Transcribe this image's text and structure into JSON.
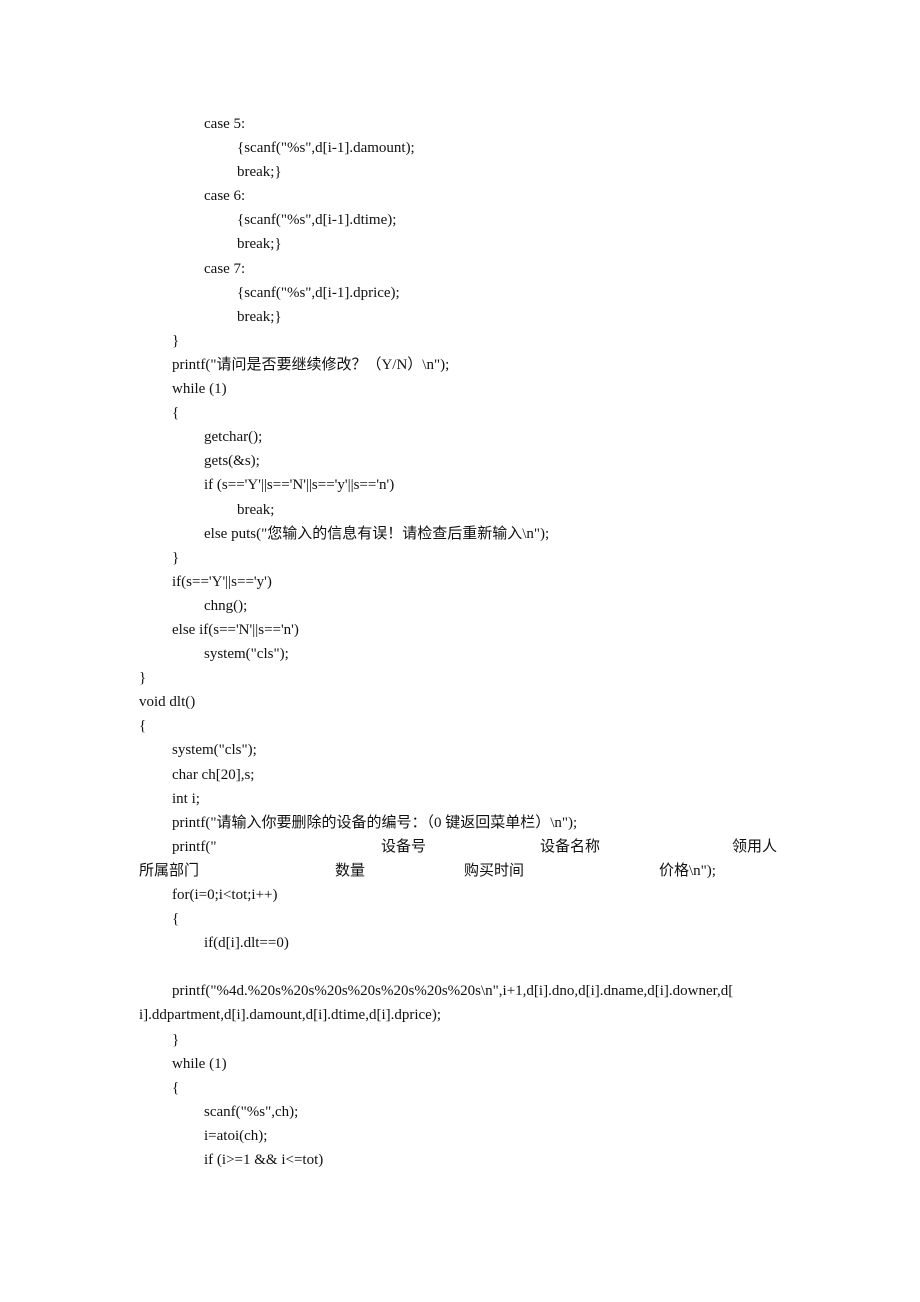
{
  "document": {
    "lines": [
      {
        "indent": 2,
        "text": "case 5:"
      },
      {
        "indent": 3,
        "text": "{scanf(\"%s\",d[i-1].damount);"
      },
      {
        "indent": 3,
        "text": "break;}"
      },
      {
        "indent": 2,
        "text": "case 6:"
      },
      {
        "indent": 3,
        "text": "{scanf(\"%s\",d[i-1].dtime);"
      },
      {
        "indent": 3,
        "text": "break;}"
      },
      {
        "indent": 2,
        "text": "case 7:"
      },
      {
        "indent": 3,
        "text": "{scanf(\"%s\",d[i-1].dprice);"
      },
      {
        "indent": 3,
        "text": "break;}"
      },
      {
        "indent": 1,
        "text": "}"
      },
      {
        "indent": 1,
        "text": "printf(\"请问是否要继续修改？（Y/N）\\n\");"
      },
      {
        "indent": 1,
        "text": "while (1)"
      },
      {
        "indent": 1,
        "text": "{"
      },
      {
        "indent": 2,
        "text": "getchar();"
      },
      {
        "indent": 2,
        "text": "gets(&s);"
      },
      {
        "indent": 2,
        "text": "if (s=='Y'||s=='N'||s=='y'||s=='n')"
      },
      {
        "indent": 3,
        "text": "break;"
      },
      {
        "indent": 2,
        "text": "else puts(\"您输入的信息有误！请检查后重新输入\\n\");"
      },
      {
        "indent": 1,
        "text": "}"
      },
      {
        "indent": 1,
        "text": "if(s=='Y'||s=='y')"
      },
      {
        "indent": 2,
        "text": "chng();"
      },
      {
        "indent": 1,
        "text": "else if(s=='N'||s=='n')"
      },
      {
        "indent": 2,
        "text": "system(\"cls\");"
      },
      {
        "indent": 0,
        "text": "}"
      },
      {
        "indent": 0,
        "text": "void dlt()"
      },
      {
        "indent": 0,
        "text": "{"
      },
      {
        "indent": 1,
        "text": "system(\"cls\");"
      },
      {
        "indent": 1,
        "text": "char ch[20],s;"
      },
      {
        "indent": 1,
        "text": "int i;"
      },
      {
        "indent": 1,
        "text": "printf(\"请输入你要删除的设备的编号：（0 键返回菜单栏）\\n\");"
      }
    ],
    "header_printf": {
      "line1": {
        "prefix": "printf(\"",
        "col1": "设备号",
        "col2": "设备名称",
        "col3": "领用人"
      },
      "line2": {
        "col1": "所属部门",
        "col2": "数量",
        "col3": "购买时间",
        "col4": "价格\\n\");"
      }
    },
    "lines_after": [
      {
        "indent": 1,
        "text": "for(i=0;i<tot;i++)"
      },
      {
        "indent": 1,
        "text": "{"
      },
      {
        "indent": 2,
        "text": "if(d[i].dlt==0)"
      },
      {
        "indent": -1,
        "text": ""
      },
      {
        "indent": 1,
        "text": "printf(\"%4d.%20s%20s%20s%20s%20s%20s%20s\\n\",i+1,d[i].dno,d[i].dname,d[i].downer,d["
      },
      {
        "indent": 0,
        "text": "i].ddpartment,d[i].damount,d[i].dtime,d[i].dprice);"
      },
      {
        "indent": 1,
        "text": "}"
      },
      {
        "indent": 1,
        "text": "while (1)"
      },
      {
        "indent": 1,
        "text": "{"
      },
      {
        "indent": 2,
        "text": "scanf(\"%s\",ch);"
      },
      {
        "indent": 2,
        "text": "i=atoi(ch);"
      },
      {
        "indent": 2,
        "text": "if (i>=1 && i<=tot)"
      }
    ]
  }
}
